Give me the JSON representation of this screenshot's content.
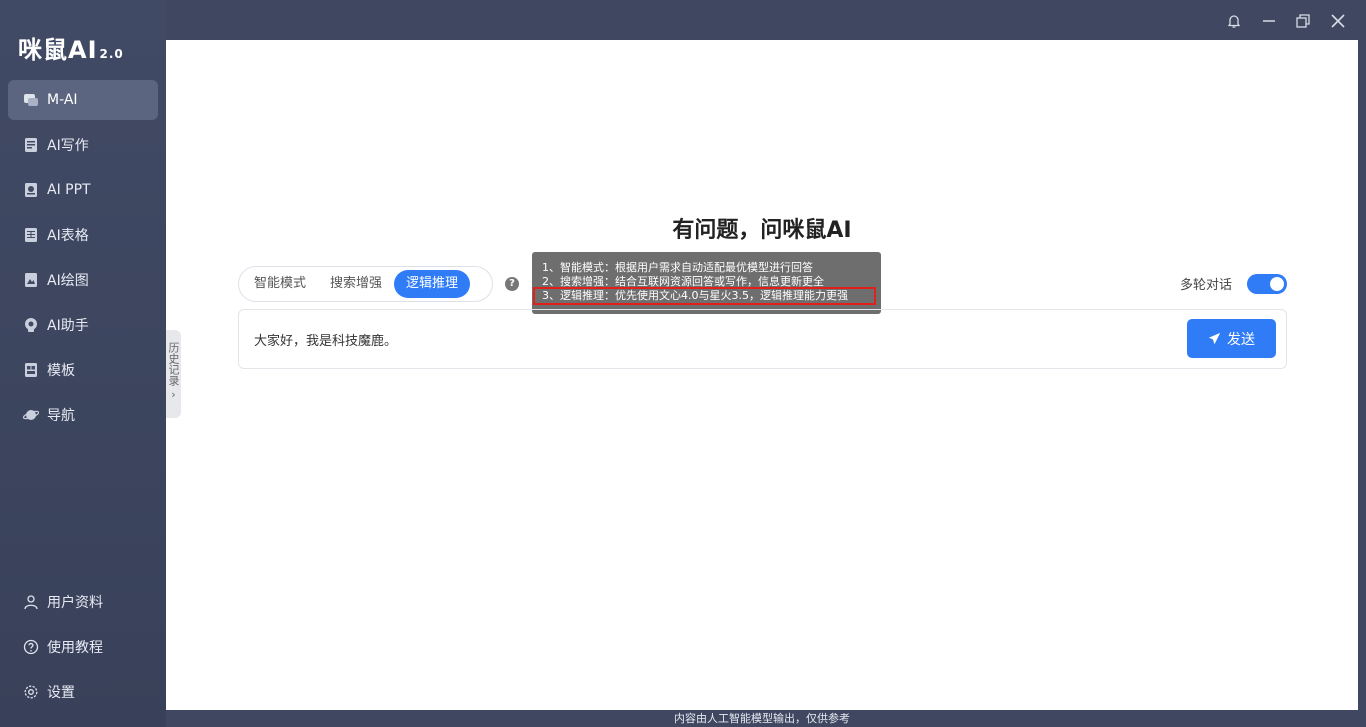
{
  "app": {
    "logo": "咪鼠AI",
    "version": "2.0"
  },
  "sidebar": {
    "items": [
      {
        "label": "M-AI",
        "icon": "chat-icon",
        "active": true
      },
      {
        "label": "AI写作",
        "icon": "document-icon"
      },
      {
        "label": "AI PPT",
        "icon": "slides-icon"
      },
      {
        "label": "AI表格",
        "icon": "table-icon"
      },
      {
        "label": "AI绘图",
        "icon": "paint-icon"
      },
      {
        "label": "AI助手",
        "icon": "brain-icon"
      },
      {
        "label": "模板",
        "icon": "template-icon"
      },
      {
        "label": "导航",
        "icon": "planet-icon"
      }
    ],
    "bottom": [
      {
        "label": "用户资料",
        "icon": "user-icon"
      },
      {
        "label": "使用教程",
        "icon": "help-circle-icon"
      },
      {
        "label": "设置",
        "icon": "gear-icon"
      }
    ]
  },
  "history_tab": "历史记录",
  "main": {
    "title": "有问题，问咪鼠AI",
    "modes": [
      {
        "label": "智能模式"
      },
      {
        "label": "搜索增强"
      },
      {
        "label": "逻辑推理",
        "active": true
      }
    ],
    "tooltip": {
      "lines": [
        "1、智能模式：根据用户需求自动适配最优模型进行回答",
        "2、搜索增强：结合互联网资源回答或写作，信息更新更全",
        "3、逻辑推理：优先使用文心4.0与星火3.5，逻辑推理能力更强"
      ]
    },
    "multiturn_label": "多轮对话",
    "multiturn_enabled": true,
    "input_text": "大家好，我是科技魔鹿。",
    "send_label": "发送"
  },
  "footer": "内容由人工智能模型输出，仅供参考",
  "colors": {
    "sidebar_bg": "#3f4761",
    "accent": "#2f7cf6",
    "highlight_box": "#e0201a"
  }
}
